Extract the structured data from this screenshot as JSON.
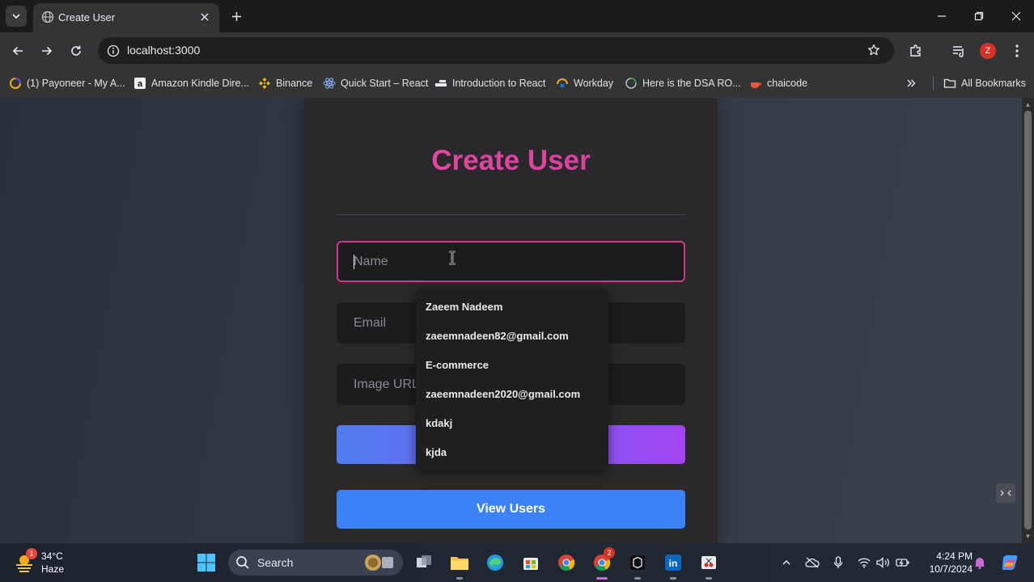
{
  "browser": {
    "tab_title": "Create User",
    "url": "localhost:3000",
    "profile_initial": "Z",
    "bookmarks": [
      {
        "label": "(1) Payoneer - My A...",
        "icon": "payoneer-icon"
      },
      {
        "label": "Amazon Kindle Dire...",
        "icon": "amazon-icon"
      },
      {
        "label": "Binance",
        "icon": "binance-icon"
      },
      {
        "label": "Quick Start – React",
        "icon": "react-icon"
      },
      {
        "label": "Introduction to React",
        "icon": "page-icon"
      },
      {
        "label": "Workday",
        "icon": "workday-icon"
      },
      {
        "label": "Here is the DSA RO...",
        "icon": "circle-icon"
      },
      {
        "label": "chaicode",
        "icon": "chaicode-icon"
      }
    ],
    "all_bookmarks_label": "All Bookmarks"
  },
  "form": {
    "title": "Create User",
    "name_placeholder": "Name",
    "email_placeholder": "Email",
    "image_placeholder": "Image URL",
    "view_button_label": "View Users"
  },
  "autofill": {
    "suggestions": [
      "Zaeem Nadeem",
      "zaeemnadeen82@gmail.com",
      "E-commerce",
      "zaeemnadeen2020@gmail.com",
      "kdakj",
      "kjda"
    ]
  },
  "taskbar": {
    "weather_temp": "34°C",
    "weather_desc": "Haze",
    "weather_badge": "1",
    "search_label": "Search",
    "chrome_badge": "2",
    "time": "4:24 PM",
    "date": "10/7/2024"
  },
  "colors": {
    "title_gradient_start": "#e94aa5",
    "focus_border": "#d6358f",
    "view_button": "#3b82f6",
    "submit_gradient_start": "#4f7cf0",
    "submit_gradient_end": "#a444f0"
  }
}
